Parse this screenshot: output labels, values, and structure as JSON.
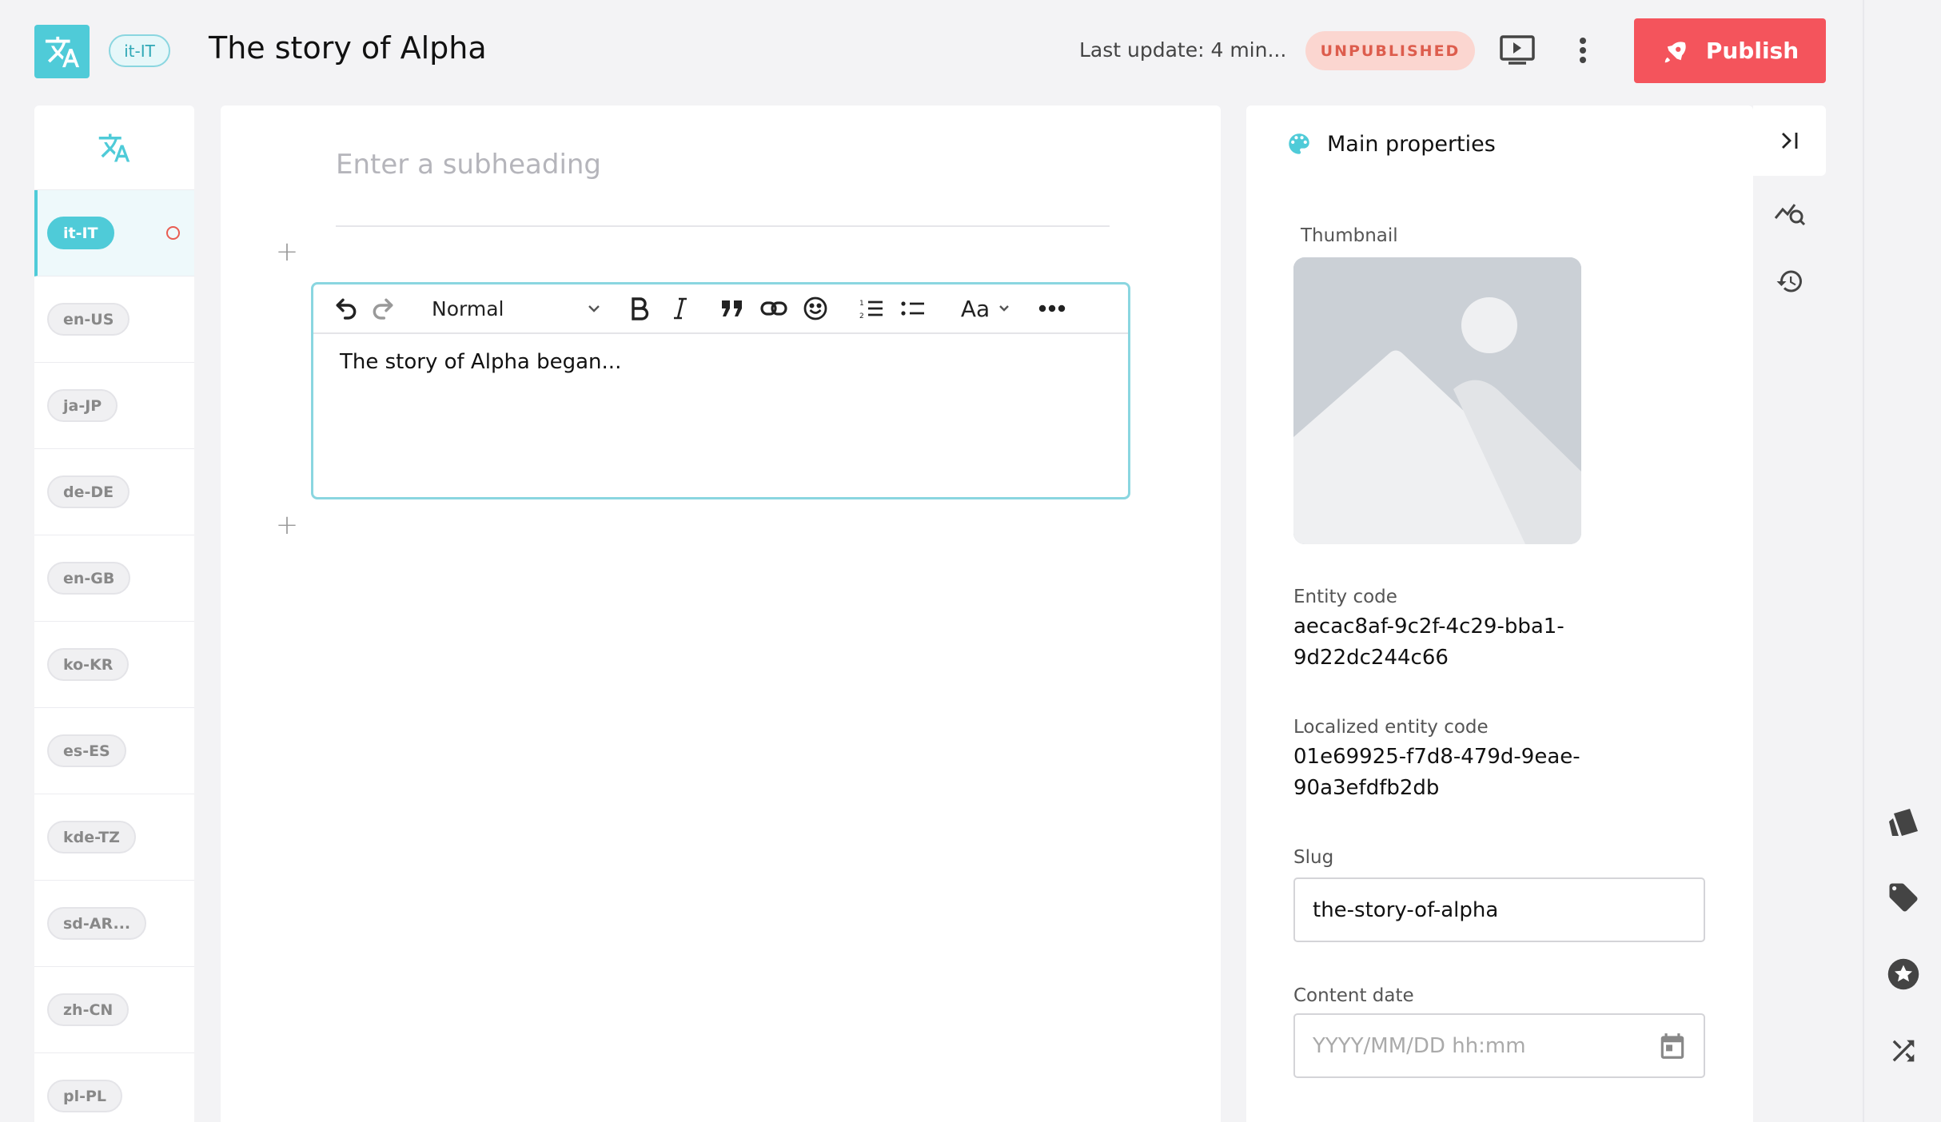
{
  "header": {
    "title": "The story of Alpha",
    "locale_badge": "it-IT",
    "last_update": "Last update: 4 min...",
    "status": "UNPUBLISHED",
    "publish_label": "Publish"
  },
  "languages": {
    "items": [
      {
        "code": "it-IT",
        "active": true
      },
      {
        "code": "en-US",
        "active": false
      },
      {
        "code": "ja-JP",
        "active": false
      },
      {
        "code": "de-DE",
        "active": false
      },
      {
        "code": "en-GB",
        "active": false
      },
      {
        "code": "ko-KR",
        "active": false
      },
      {
        "code": "es-ES",
        "active": false
      },
      {
        "code": "kde-TZ",
        "active": false
      },
      {
        "code": "sd-AR...",
        "active": false
      },
      {
        "code": "zh-CN",
        "active": false
      },
      {
        "code": "pl-PL",
        "active": false
      }
    ]
  },
  "editor": {
    "subheading_placeholder": "Enter a subheading",
    "block_format": "Normal",
    "font_button": "Aa",
    "content": "The story of Alpha began..."
  },
  "properties": {
    "heading": "Main properties",
    "thumbnail_label": "Thumbnail",
    "entity_code_label": "Entity code",
    "entity_code_line1": "aecac8af-9c2f-4c29-bba1-",
    "entity_code_line2": "9d22dc244c66",
    "localized_code_label": "Localized entity code",
    "localized_code_line1": "01e69925-f7d8-479d-9eae-",
    "localized_code_line2": "90a3efdfb2db",
    "slug_label": "Slug",
    "slug_value": "the-story-of-alpha",
    "content_date_label": "Content date",
    "content_date_placeholder": "YYYY/MM/DD hh:mm"
  },
  "colors": {
    "accent": "#4fcbd8",
    "publish": "#f4545c",
    "status_bg": "#fbd6d0",
    "status_text": "#dd5d4d"
  },
  "icons": {
    "logo": "translate-icon",
    "preview": "preview-icon",
    "more": "kebab-menu-icon",
    "publish": "rocket-icon",
    "props": "palette-icon",
    "collapse": "collapse-right-icon",
    "seo": "seo-analytics-icon",
    "history": "history-icon",
    "categories": "categories-icon",
    "tags": "tag-icon",
    "featured": "star-icon",
    "related": "shuffle-icon",
    "date": "calendar-icon"
  }
}
